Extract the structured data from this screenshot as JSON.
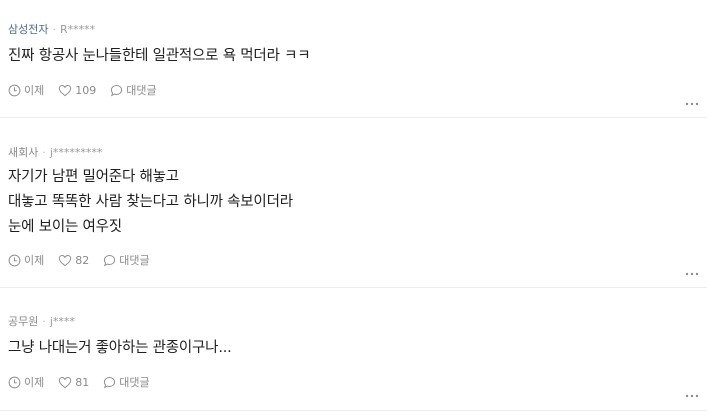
{
  "comments": [
    {
      "company": "삼성전자",
      "separator": "·",
      "author": "R*****",
      "lines": [
        "진짜 항공사 눈나들한테 일관적으로 욕 먹더라 ㅋㅋ"
      ],
      "time": "이제",
      "likes": "109",
      "reply": "대댓글"
    },
    {
      "company": "새회사",
      "separator": "·",
      "author": "j*********",
      "lines": [
        "자기가 남편 밀어준다 해놓고",
        "대놓고 똑똑한 사람 찾는다고 하니까 속보이더라",
        "눈에 보이는 여우짓"
      ],
      "time": "이제",
      "likes": "82",
      "reply": "대댓글"
    },
    {
      "company": "공무원",
      "separator": "·",
      "author": "j****",
      "lines": [
        "그냥 나대는거 좋아하는 관종이구나..."
      ],
      "time": "이제",
      "likes": "81",
      "reply": "대댓글"
    }
  ],
  "icons": {
    "time": "clock-icon",
    "like": "heart-icon",
    "reply": "speech-bubble-icon",
    "more": "more-dots-icon"
  },
  "colors": {
    "company_link": "#4f6f8f",
    "muted": "#8a8a8a",
    "divider": "#ececec"
  }
}
